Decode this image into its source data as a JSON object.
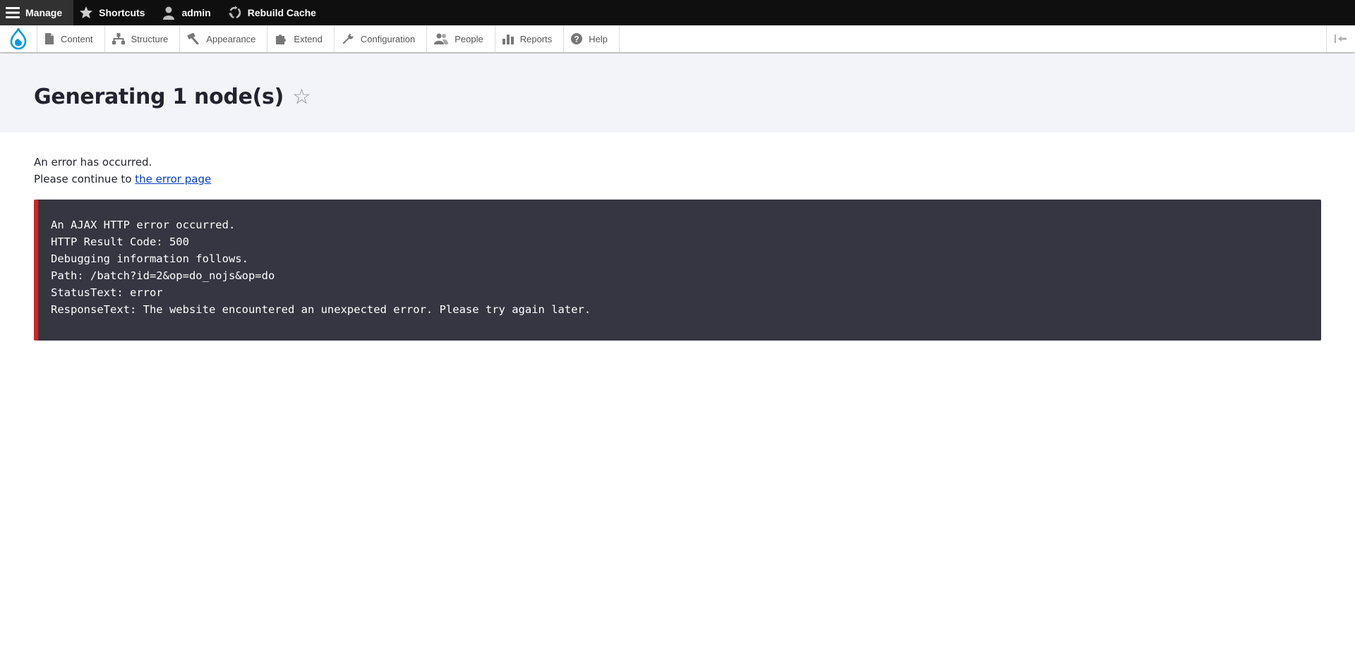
{
  "toolbar": {
    "manage": "Manage",
    "shortcuts": "Shortcuts",
    "user": "admin",
    "rebuild_cache": "Rebuild Cache"
  },
  "tray": {
    "items": [
      {
        "label": "Content",
        "icon": "file-icon"
      },
      {
        "label": "Structure",
        "icon": "sitemap-icon"
      },
      {
        "label": "Appearance",
        "icon": "paint-icon"
      },
      {
        "label": "Extend",
        "icon": "puzzle-icon"
      },
      {
        "label": "Configuration",
        "icon": "wrench-icon"
      },
      {
        "label": "People",
        "icon": "people-icon"
      },
      {
        "label": "Reports",
        "icon": "bar-chart-icon"
      },
      {
        "label": "Help",
        "icon": "help-icon"
      }
    ]
  },
  "page": {
    "title": "Generating 1 node(s)",
    "star": "☆"
  },
  "message": {
    "line1": "An error has occurred.",
    "line2_prefix": "Please continue to ",
    "link_text": "the error page"
  },
  "error": {
    "lines": [
      "An AJAX HTTP error occurred.",
      "HTTP Result Code: 500",
      "Debugging information follows.",
      "Path: /batch?id=2&op=do_nojs&op=do",
      "StatusText: error",
      "ResponseText: The website encountered an unexpected error. Please try again later."
    ]
  },
  "colors": {
    "toolbar_bg": "#0f0f0f",
    "header_bg": "#f3f4f9",
    "error_bg": "#353641",
    "error_accent": "#d72222",
    "link": "#003ecc",
    "drupal_blue": "#009cde"
  }
}
